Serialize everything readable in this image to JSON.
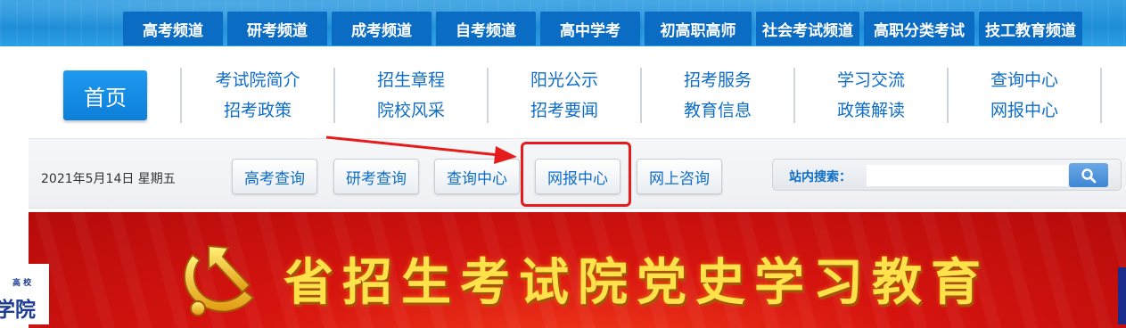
{
  "channels": [
    "高考频道",
    "研考频道",
    "成考频道",
    "自考频道",
    "高中学考",
    "初高职高师",
    "社会考试频道",
    "高职分类考试",
    "技工教育频道"
  ],
  "home_label": "首页",
  "nav_columns": [
    {
      "top": "考试院简介",
      "bottom": "招考政策"
    },
    {
      "top": "招生章程",
      "bottom": "院校风采"
    },
    {
      "top": "阳光公示",
      "bottom": "招考要闻"
    },
    {
      "top": "招考服务",
      "bottom": "教育信息"
    },
    {
      "top": "学习交流",
      "bottom": "政策解读"
    },
    {
      "top": "查询中心",
      "bottom": "网报中心"
    }
  ],
  "date_text": "2021年5月14日 星期五",
  "quick_buttons": [
    "高考查询",
    "研考查询",
    "查询中心",
    "网报中心",
    "网上咨询"
  ],
  "search": {
    "label": "站内搜索：",
    "placeholder": ""
  },
  "banner_title": "省招生考试院党史学习教育",
  "side_logo": {
    "small": "高 校",
    "big": "学院"
  },
  "colors": {
    "accent_blue": "#0e6dc7",
    "channel_bg": "#0b6cc4",
    "highlight_red": "#e61b1b",
    "banner_red": "#d6140f",
    "banner_text": "#ffe14a"
  }
}
